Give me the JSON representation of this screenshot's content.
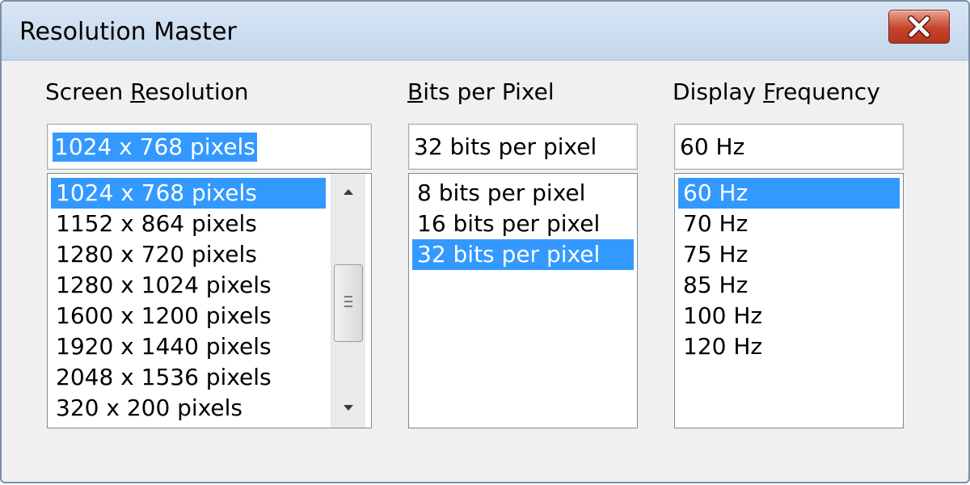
{
  "window": {
    "title": "Resolution Master",
    "close_icon": "close-icon"
  },
  "resolution": {
    "label_pre": "Screen ",
    "label_accel": "R",
    "label_post": "esolution",
    "value": "1024 x 768 pixels",
    "items": [
      {
        "label": "1024 x 768 pixels",
        "selected": true
      },
      {
        "label": "1152 x 864 pixels",
        "selected": false
      },
      {
        "label": "1280 x 720 pixels",
        "selected": false
      },
      {
        "label": "1280 x 1024 pixels",
        "selected": false
      },
      {
        "label": "1600 x 1200 pixels",
        "selected": false
      },
      {
        "label": "1920 x 1440 pixels",
        "selected": false
      },
      {
        "label": "2048 x 1536 pixels",
        "selected": false
      },
      {
        "label": "320 x 200 pixels",
        "selected": false
      }
    ]
  },
  "bits": {
    "label_pre": "",
    "label_accel": "B",
    "label_post": "its per Pixel",
    "value": "32 bits per pixel",
    "items": [
      {
        "label": "8 bits per pixel",
        "selected": false
      },
      {
        "label": "16 bits per pixel",
        "selected": false
      },
      {
        "label": "32 bits per pixel",
        "selected": true
      }
    ]
  },
  "frequency": {
    "label_pre": "Display ",
    "label_accel": "F",
    "label_post": "requency",
    "value": "60 Hz",
    "items": [
      {
        "label": "60 Hz",
        "selected": true
      },
      {
        "label": "70 Hz",
        "selected": false
      },
      {
        "label": "75 Hz",
        "selected": false
      },
      {
        "label": "85 Hz",
        "selected": false
      },
      {
        "label": "100 Hz",
        "selected": false
      },
      {
        "label": "120 Hz",
        "selected": false
      }
    ]
  },
  "colors": {
    "selection": "#3399ff",
    "close_button": "#c6442a"
  }
}
